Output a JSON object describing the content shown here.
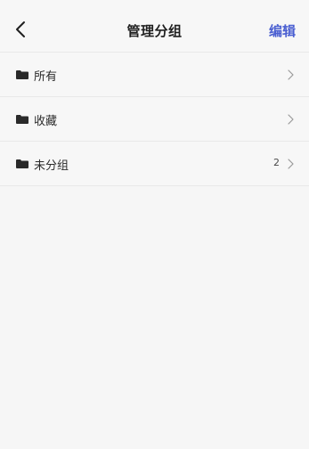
{
  "header": {
    "title": "管理分组",
    "edit_label": "编辑"
  },
  "groups": [
    {
      "label": "所有",
      "count": ""
    },
    {
      "label": "收藏",
      "count": ""
    },
    {
      "label": "未分组",
      "count": "2"
    }
  ],
  "icons": {
    "back": "chevron-left-icon",
    "folder": "folder-icon",
    "row_arrow": "chevron-right-icon"
  },
  "colors": {
    "accent": "#4a5fd1",
    "background": "#f6f6f6",
    "divider": "#e9e9e9"
  }
}
